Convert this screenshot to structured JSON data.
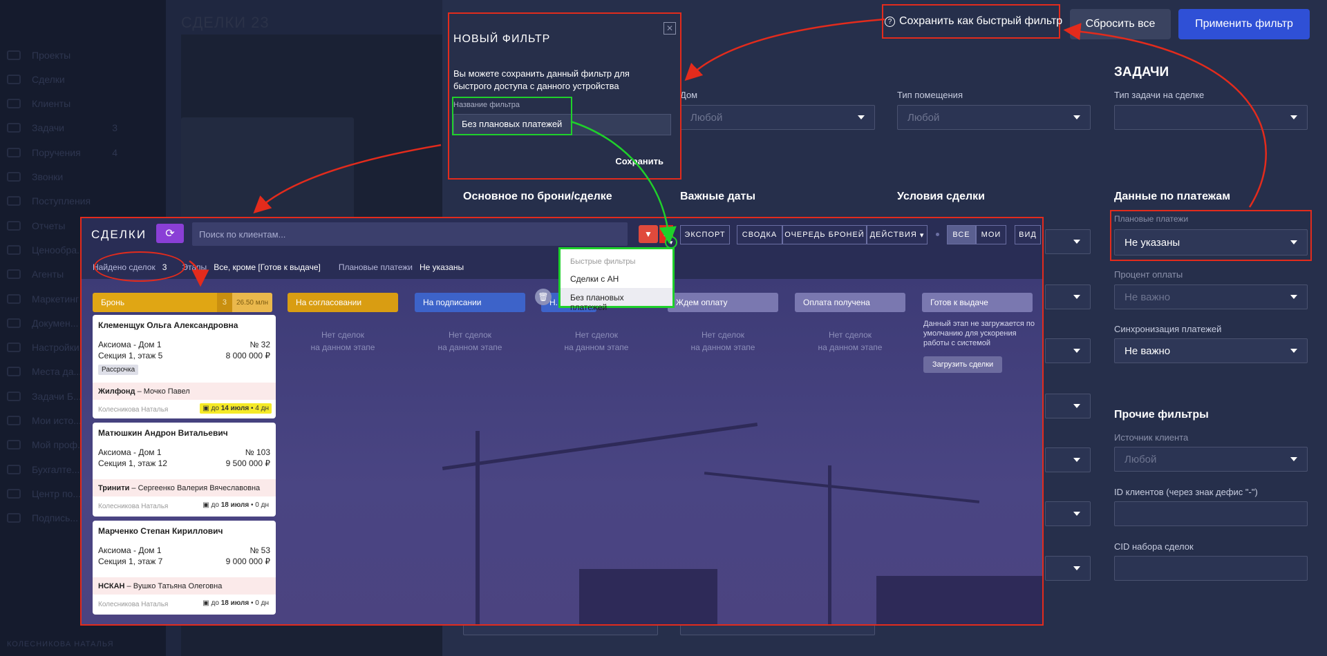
{
  "background": {
    "sidebar_header": "",
    "sidebar_items": [
      {
        "label": "Проекты",
        "count": ""
      },
      {
        "label": "Сделки",
        "count": ""
      },
      {
        "label": "Клиенты",
        "count": ""
      },
      {
        "label": "Задачи",
        "count": "3"
      },
      {
        "label": "Поручения",
        "count": "4"
      },
      {
        "label": "Звонки",
        "count": ""
      },
      {
        "label": "Поступления",
        "count": ""
      },
      {
        "label": "Отчеты",
        "count": ""
      },
      {
        "label": "Ценообра...",
        "count": ""
      },
      {
        "label": "Агенты",
        "count": ""
      },
      {
        "label": "Маркетинг",
        "count": ""
      },
      {
        "label": "Докумен...",
        "count": ""
      },
      {
        "label": "Настройки",
        "count": ""
      },
      {
        "label": "Места да...",
        "count": ""
      },
      {
        "label": "Задачи Б...",
        "count": ""
      },
      {
        "label": "Мои исто...",
        "count": ""
      },
      {
        "label": "Мой проф...",
        "count": ""
      },
      {
        "label": "Бухгалте...",
        "count": ""
      },
      {
        "label": "Центр по...",
        "count": ""
      },
      {
        "label": "Подпись...",
        "count": ""
      }
    ],
    "footer_user": "КОЛЕСНИКОВА НАТАЛЬЯ",
    "page_title": "СДЕЛКИ",
    "page_count": "23"
  },
  "toolbar_top": {
    "save_quick": "Сохранить как быстрый фильтр",
    "reset_all": "Сбросить все",
    "apply": "Применить фильтр"
  },
  "filters": {
    "col2_dom_label": "Дом",
    "col2_dom_value": "Любой",
    "col3_type_label": "Тип помещения",
    "col3_type_value": "Любой",
    "tasks_title": "ЗАДАЧИ",
    "task_type_label": "Тип задачи на сделке",
    "sec_main": "Основное по брони/сделке",
    "sec_dates": "Важные даты",
    "sec_terms": "Условия сделки",
    "sec_payments": "Данные по платежам",
    "planned_label": "Плановые платежи",
    "planned_value": "Не указаны",
    "percent_label": "Процент оплаты",
    "percent_value": "Не важно",
    "sync_label": "Синхронизация платежей",
    "sync_value": "Не важно",
    "other_title": "Прочие фильтры",
    "source_label": "Источник клиента",
    "source_value": "Любой",
    "ids_label": "ID клиентов (через знак дефис \"-\")",
    "cid_label": "CID набора сделок"
  },
  "modal": {
    "title": "НОВЫЙ ФИЛЬТР",
    "text": "Вы можете сохранить данный фильтр для быстрого доступа с данного устройства",
    "name_label": "Название фильтра",
    "name_value": "Без плановых платежей",
    "save": "Сохранить",
    "close": "✕"
  },
  "deals": {
    "title": "СДЕЛКИ",
    "search_placeholder": "Поиск по клиентам...",
    "export": "ЭКСПОРТ",
    "summary": "СВОДКА",
    "queue": "ОЧЕРЕДЬ БРОНЕЙ",
    "actions": "ДЕЙСТВИЯ",
    "all": "ВСЕ",
    "mine": "МОИ",
    "view": "ВИД",
    "found_label": "Найдено сделок",
    "found_count": "3",
    "stages_label": "Этапы",
    "stages_value": "Все, кроме [Готов к выдаче]",
    "planned_label": "Плановые платежи",
    "planned_value": "Не указаны",
    "quick_filters": {
      "header": "Быстрые фильтры",
      "items": [
        "Сделки с АН",
        "Без плановых платежей"
      ]
    },
    "stages": [
      {
        "label": "Бронь",
        "count": "3",
        "sum": "26.50 млн",
        "color": "#e0a614"
      },
      {
        "label": "На согласовании",
        "color": "#d99d12"
      },
      {
        "label": "На подписании",
        "color": "#3d63c9"
      },
      {
        "label": "Н...",
        "color": "#3d63c9"
      },
      {
        "label": "Ждем оплату",
        "color": "#7a78b0"
      },
      {
        "label": "Оплата получена",
        "color": "#7a78b0"
      },
      {
        "label": "Готов к выдаче",
        "color": "#7a78b0"
      }
    ],
    "no_deals": "Нет сделок\nна данном этапе",
    "ready_note": "Данный этап не загружается по умолчанию для ускорения работы с системой",
    "load_btn": "Загрузить сделки",
    "cards": [
      {
        "name": "Клеменщук Ольга Александровна",
        "house": "Аксиома - Дом 1",
        "num": "№ 32",
        "section": "Секция 1, этаж 5",
        "price": "8 000 000 ₽",
        "tag": "Рассрочка",
        "agency": "Жилфонд",
        "agent": " – Мочко Павел",
        "manager": "Колесникова Наталья",
        "due_prefix": "до ",
        "due_date": "14 июля",
        "due_suffix": " • 4 дн"
      },
      {
        "name": "Матюшкин Андрон Витальевич",
        "house": "Аксиома - Дом 1",
        "num": "№ 103",
        "section": "Секция 1, этаж 12",
        "price": "9 500 000 ₽",
        "agency": "Тринити",
        "agent": " – Сергеенко Валерия Вячеславовна",
        "manager": "Колесникова Наталья",
        "due_prefix": "до ",
        "due_date": "18 июля",
        "due_suffix": " • 0 дн"
      },
      {
        "name": "Марченко Степан Кириллович",
        "house": "Аксиома - Дом 1",
        "num": "№ 53",
        "section": "Секция 1, этаж 7",
        "price": "9 000 000 ₽",
        "agency": "НСКАН",
        "agent": " – Вушко Татьяна Олеговна",
        "manager": "Колесникова Наталья",
        "due_prefix": "до ",
        "due_date": "18 июля",
        "due_suffix": " • 0 дн"
      }
    ]
  },
  "colors": {
    "accent_red": "#e32b1c",
    "accent_green": "#1fd12b",
    "apply_blue": "#2f50d6"
  }
}
